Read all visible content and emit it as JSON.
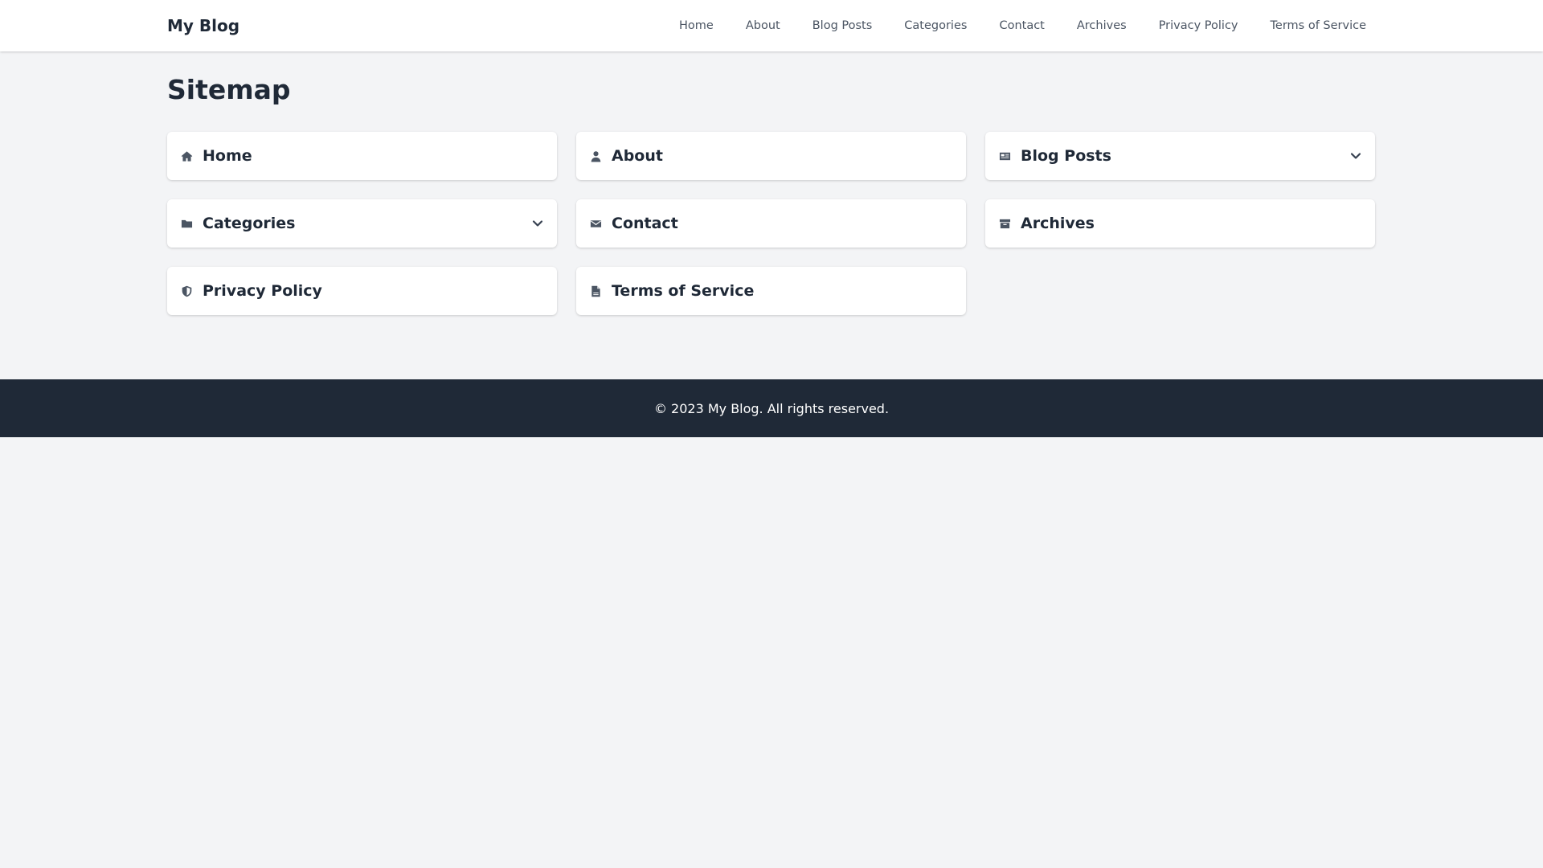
{
  "header": {
    "brand": "My Blog",
    "nav": [
      {
        "label": "Home"
      },
      {
        "label": "About"
      },
      {
        "label": "Blog Posts"
      },
      {
        "label": "Categories"
      },
      {
        "label": "Contact"
      },
      {
        "label": "Archives"
      },
      {
        "label": "Privacy Policy"
      },
      {
        "label": "Terms of Service"
      }
    ]
  },
  "main": {
    "title": "Sitemap",
    "cards": [
      {
        "label": "Home",
        "icon": "home-icon",
        "expandable": false
      },
      {
        "label": "About",
        "icon": "user-icon",
        "expandable": false
      },
      {
        "label": "Blog Posts",
        "icon": "newspaper-icon",
        "expandable": true
      },
      {
        "label": "Categories",
        "icon": "folder-icon",
        "expandable": true
      },
      {
        "label": "Contact",
        "icon": "envelope-icon",
        "expandable": false
      },
      {
        "label": "Archives",
        "icon": "archive-icon",
        "expandable": false
      },
      {
        "label": "Privacy Policy",
        "icon": "shield-icon",
        "expandable": false
      },
      {
        "label": "Terms of Service",
        "icon": "document-icon",
        "expandable": false
      }
    ]
  },
  "footer": {
    "text": "© 2023 My Blog. All rights reserved."
  },
  "colors": {
    "background": "#f3f4f6",
    "surface": "#ffffff",
    "text": "#1f2937",
    "muted": "#4b5563",
    "footer": "#1f2937"
  }
}
